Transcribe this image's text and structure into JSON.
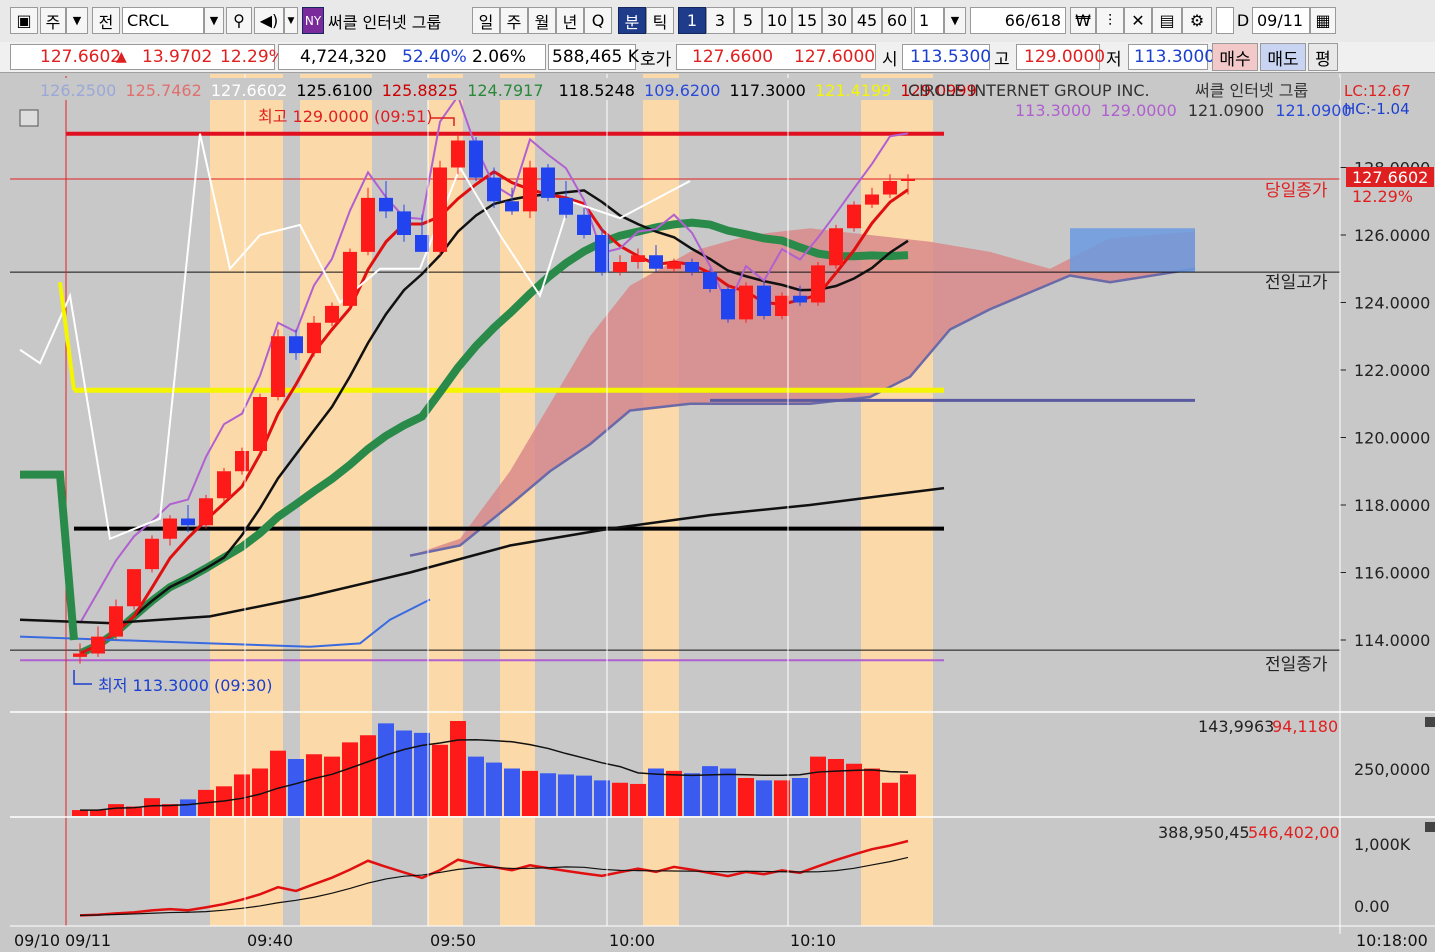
{
  "toolbar": {
    "period_code": "주",
    "prev_label": "전",
    "symbol": "CRCL",
    "exchange_badge": "NY",
    "stock_name": "써클 인터넷 그룹",
    "periods": [
      "일",
      "주",
      "월",
      "년",
      "Q",
      "분",
      "틱"
    ],
    "active_period": "분",
    "intervals": [
      "1",
      "3",
      "5",
      "10",
      "15",
      "30",
      "45",
      "60"
    ],
    "active_interval": "1",
    "multiplier": "1",
    "count_current": "66",
    "count_total": "/618",
    "date_checkbox_label": "D",
    "date_value": "09/11"
  },
  "infobar": {
    "price": "127.6602",
    "arrow": "▲",
    "change": "13.9702",
    "change_pct": "12.29%",
    "volume": "4,724,320",
    "volume_ratio": "52.40%",
    "turnover_rate": "2.06%",
    "amount": "588,465 K",
    "quote_label": "호가",
    "ask": "127.6600",
    "bid": "127.6000",
    "open_label": "시",
    "open": "113.5300",
    "high_label": "고",
    "high": "129.0000",
    "low_label": "저",
    "low": "113.3000",
    "buy_button": "매수",
    "sell_button": "매도",
    "avg_button": "평"
  },
  "chart_header": {
    "ma_values": [
      "126.2500",
      "125.7462",
      "127.6602",
      "125.6100",
      "125.8825",
      "124.7917",
      "118.5248",
      "109.6200",
      "117.3000",
      "121.4199",
      "129.0999"
    ],
    "ma_colors": [
      "#9aa8d8",
      "#e07070",
      "#ffffff",
      "#000000",
      "#cc0000",
      "#2a8a3a",
      "#000000",
      "#2a4ad8",
      "#000000",
      "#f5f500",
      "#cc0000"
    ],
    "stock_full_name": "CIRCLE INTERNET GROUP INC.",
    "stock_kr_name": "써클 인터넷 그룹",
    "lc_label": "LC:12.67",
    "hc_label": "HC:-1.04",
    "line2_values": [
      "113.3000",
      "129.0000",
      "121.0900",
      "121.0900"
    ],
    "line2_colors": [
      "#b060d0",
      "#b060d0",
      "#333333",
      "#2a4ad8"
    ]
  },
  "annotations": {
    "high_note": "최고 129.0000 (09:51)",
    "low_note": "최저 113.3000 (09:30)",
    "today_close_label": "당일종가",
    "prev_high_label": "전일고가",
    "prev_close_label": "전일종가",
    "last_price_tag": "127.6602",
    "last_pct_tag": "12.29%"
  },
  "volume_panel": {
    "values_label_black": "143,9963",
    "values_label_red": "94,1180",
    "axis_tick": "250,0000"
  },
  "obv_panel": {
    "values_label_black": "388,950,45",
    "values_label_red": "546,402,00",
    "axis_ticks": [
      "1,000K",
      "0.00"
    ]
  },
  "chart_data": {
    "type": "candlestick",
    "title": "CIRCLE INTERNET GROUP INC.",
    "interval": "1 min",
    "x_ticks": [
      "09/10",
      "09/11",
      "09:40",
      "09:50",
      "10:00",
      "10:10",
      "10:18:00"
    ],
    "ylim": [
      112.4,
      130.5
    ],
    "y_ticks": [
      "114.0000",
      "116.0000",
      "118.0000",
      "120.0000",
      "122.0000",
      "124.0000",
      "126.0000",
      "128.0000"
    ],
    "reference_lines": {
      "today_close": 127.66,
      "prev_high": 124.9,
      "prev_close": 113.7,
      "day_high": 129.0,
      "day_low": 113.3,
      "mid_line": 121.09
    },
    "candles": [
      {
        "o": 113.5,
        "h": 113.9,
        "l": 113.3,
        "c": 113.6
      },
      {
        "o": 113.6,
        "h": 114.4,
        "l": 113.5,
        "c": 114.1
      },
      {
        "o": 114.1,
        "h": 115.2,
        "l": 114.0,
        "c": 115.0
      },
      {
        "o": 115.0,
        "h": 116.0,
        "l": 114.9,
        "c": 116.1
      },
      {
        "o": 116.1,
        "h": 117.1,
        "l": 116.0,
        "c": 117.0
      },
      {
        "o": 117.0,
        "h": 117.7,
        "l": 116.8,
        "c": 117.6
      },
      {
        "o": 117.6,
        "h": 118.0,
        "l": 117.2,
        "c": 117.4
      },
      {
        "o": 117.4,
        "h": 118.3,
        "l": 117.3,
        "c": 118.2
      },
      {
        "o": 118.2,
        "h": 119.1,
        "l": 118.1,
        "c": 119.0
      },
      {
        "o": 119.0,
        "h": 119.7,
        "l": 118.9,
        "c": 119.6
      },
      {
        "o": 119.6,
        "h": 121.3,
        "l": 119.5,
        "c": 121.2
      },
      {
        "o": 121.2,
        "h": 123.2,
        "l": 121.1,
        "c": 123.0
      },
      {
        "o": 123.0,
        "h": 123.2,
        "l": 122.3,
        "c": 122.5
      },
      {
        "o": 122.5,
        "h": 123.6,
        "l": 122.4,
        "c": 123.4
      },
      {
        "o": 123.4,
        "h": 124.0,
        "l": 123.3,
        "c": 123.9
      },
      {
        "o": 123.9,
        "h": 125.6,
        "l": 123.8,
        "c": 125.5
      },
      {
        "o": 125.5,
        "h": 127.4,
        "l": 125.4,
        "c": 127.1
      },
      {
        "o": 127.1,
        "h": 127.6,
        "l": 126.5,
        "c": 126.7
      },
      {
        "o": 126.7,
        "h": 126.9,
        "l": 125.8,
        "c": 126.0
      },
      {
        "o": 126.0,
        "h": 126.6,
        "l": 125.6,
        "c": 125.5
      },
      {
        "o": 125.5,
        "h": 128.2,
        "l": 125.4,
        "c": 128.0
      },
      {
        "o": 128.0,
        "h": 129.0,
        "l": 127.8,
        "c": 128.8
      },
      {
        "o": 128.8,
        "h": 128.9,
        "l": 127.6,
        "c": 127.7
      },
      {
        "o": 127.7,
        "h": 128.0,
        "l": 126.8,
        "c": 127.0
      },
      {
        "o": 127.0,
        "h": 127.4,
        "l": 126.6,
        "c": 126.7
      },
      {
        "o": 126.7,
        "h": 128.2,
        "l": 126.5,
        "c": 128.0
      },
      {
        "o": 128.0,
        "h": 128.1,
        "l": 127.0,
        "c": 127.1
      },
      {
        "o": 127.1,
        "h": 127.6,
        "l": 126.5,
        "c": 126.6
      },
      {
        "o": 126.6,
        "h": 126.8,
        "l": 125.9,
        "c": 126.0
      },
      {
        "o": 126.0,
        "h": 126.2,
        "l": 124.8,
        "c": 124.9
      },
      {
        "o": 124.9,
        "h": 125.4,
        "l": 124.8,
        "c": 125.2
      },
      {
        "o": 125.2,
        "h": 125.6,
        "l": 125.0,
        "c": 125.4
      },
      {
        "o": 125.4,
        "h": 125.7,
        "l": 124.9,
        "c": 125.0
      },
      {
        "o": 125.0,
        "h": 125.3,
        "l": 124.9,
        "c": 125.2
      },
      {
        "o": 125.2,
        "h": 125.3,
        "l": 124.8,
        "c": 124.9
      },
      {
        "o": 124.9,
        "h": 125.0,
        "l": 124.3,
        "c": 124.4
      },
      {
        "o": 124.4,
        "h": 124.5,
        "l": 123.4,
        "c": 123.5
      },
      {
        "o": 123.5,
        "h": 124.6,
        "l": 123.4,
        "c": 124.5
      },
      {
        "o": 124.5,
        "h": 124.6,
        "l": 123.5,
        "c": 123.6
      },
      {
        "o": 123.6,
        "h": 124.3,
        "l": 123.5,
        "c": 124.2
      },
      {
        "o": 124.2,
        "h": 124.5,
        "l": 123.9,
        "c": 124.0
      },
      {
        "o": 124.0,
        "h": 125.2,
        "l": 123.9,
        "c": 125.1
      },
      {
        "o": 125.1,
        "h": 126.3,
        "l": 125.0,
        "c": 126.2
      },
      {
        "o": 126.2,
        "h": 127.0,
        "l": 126.1,
        "c": 126.9
      },
      {
        "o": 126.9,
        "h": 127.4,
        "l": 126.8,
        "c": 127.2
      },
      {
        "o": 127.2,
        "h": 127.8,
        "l": 127.1,
        "c": 127.6
      },
      {
        "o": 127.6,
        "h": 127.8,
        "l": 127.2,
        "c": 127.66
      }
    ],
    "volume": [
      5,
      5,
      10,
      8,
      15,
      10,
      14,
      22,
      25,
      35,
      40,
      55,
      48,
      52,
      50,
      62,
      68,
      78,
      72,
      70,
      60,
      80,
      50,
      45,
      40,
      38,
      36,
      35,
      34,
      30,
      28,
      27,
      40,
      38,
      36,
      42,
      40,
      32,
      30,
      30,
      32,
      50,
      48,
      44,
      40,
      28,
      35
    ]
  }
}
